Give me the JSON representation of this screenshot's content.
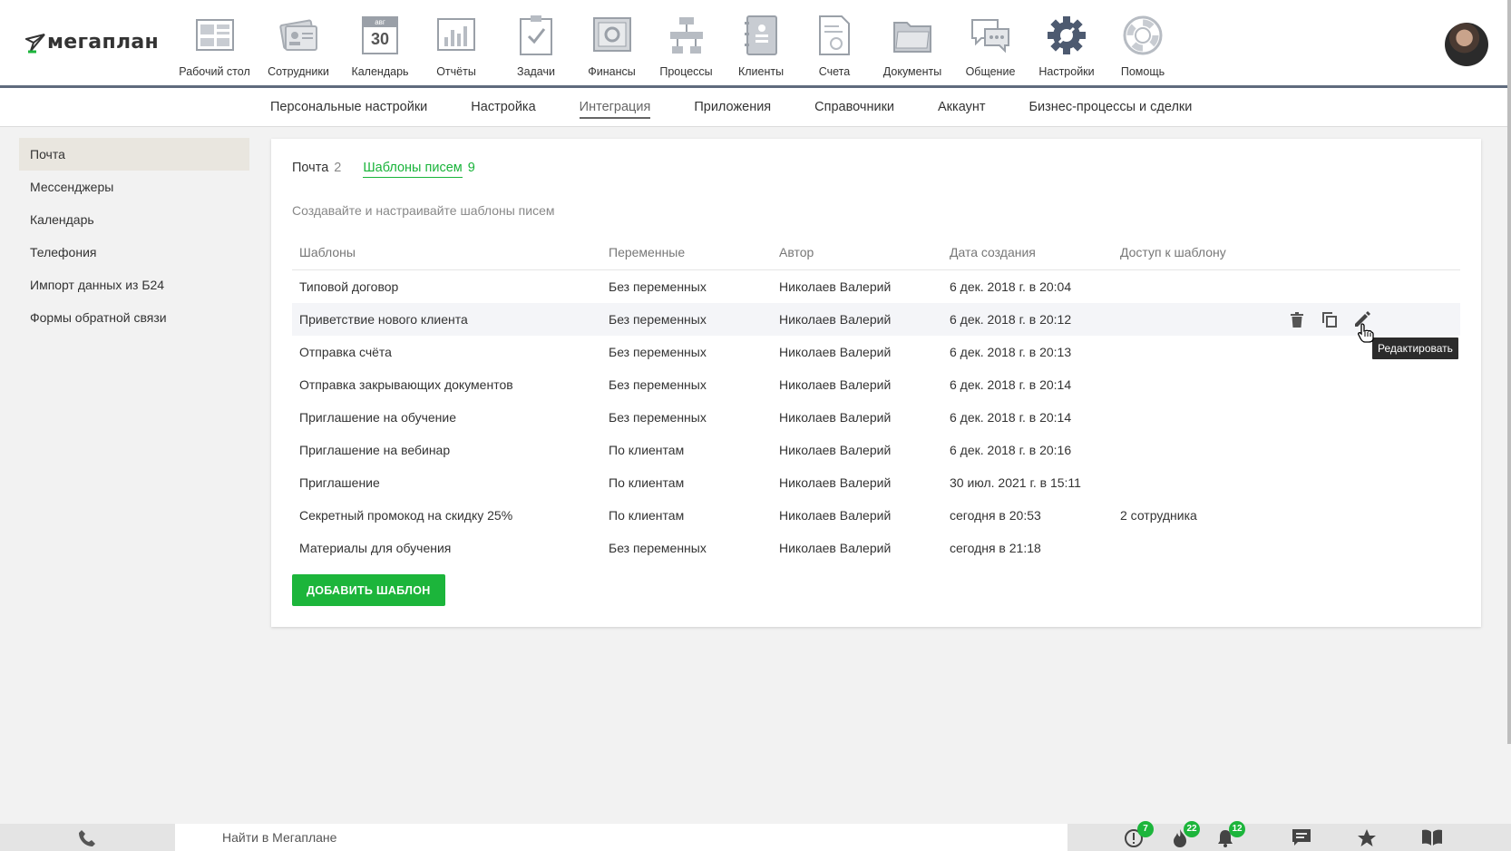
{
  "brand": {
    "name": "мегаплан"
  },
  "nav": [
    {
      "label": "Рабочий стол",
      "icon": "desktop-icon"
    },
    {
      "label": "Сотрудники",
      "icon": "employees-icon"
    },
    {
      "label": "Календарь",
      "icon": "calendar-icon",
      "month": "авг",
      "day": "30"
    },
    {
      "label": "Отчёты",
      "icon": "reports-icon"
    },
    {
      "label": "Задачи",
      "icon": "tasks-icon"
    },
    {
      "label": "Финансы",
      "icon": "finance-icon"
    },
    {
      "label": "Процессы",
      "icon": "processes-icon"
    },
    {
      "label": "Клиенты",
      "icon": "clients-icon"
    },
    {
      "label": "Счета",
      "icon": "invoices-icon"
    },
    {
      "label": "Документы",
      "icon": "documents-icon"
    },
    {
      "label": "Общение",
      "icon": "chat-icon"
    },
    {
      "label": "Настройки",
      "icon": "settings-icon",
      "active": true
    },
    {
      "label": "Помощь",
      "icon": "help-icon"
    }
  ],
  "subnav": [
    "Персональные настройки",
    "Настройка",
    "Интеграция",
    "Приложения",
    "Справочники",
    "Аккаунт",
    "Бизнес-процессы и сделки"
  ],
  "sidebar": [
    "Почта",
    "Мессенджеры",
    "Календарь",
    "Телефония",
    "Импорт данных из Б24",
    "Формы обратной связи"
  ],
  "tabs": [
    {
      "label": "Почта",
      "count": "2"
    },
    {
      "label": "Шаблоны писем",
      "count": "9"
    }
  ],
  "hint": "Создавайте и настраивайте шаблоны писем",
  "table": {
    "headers": [
      "Шаблоны",
      "Переменные",
      "Автор",
      "Дата создания",
      "Доступ к шаблону"
    ],
    "rows": [
      [
        "Типовой договор",
        "Без переменных",
        "Николаев Валерий",
        "6 дек. 2018 г. в 20:04",
        ""
      ],
      [
        "Приветствие нового клиента",
        "Без переменных",
        "Николаев Валерий",
        "6 дек. 2018 г. в 20:12",
        ""
      ],
      [
        "Отправка счёта",
        "Без переменных",
        "Николаев Валерий",
        "6 дек. 2018 г. в 20:13",
        ""
      ],
      [
        "Отправка закрывающих документов",
        "Без переменных",
        "Николаев Валерий",
        "6 дек. 2018 г. в 20:14",
        ""
      ],
      [
        "Приглашение на обучение",
        "Без переменных",
        "Николаев Валерий",
        "6 дек. 2018 г. в 20:14",
        ""
      ],
      [
        "Приглашение на вебинар",
        "По клиентам",
        "Николаев Валерий",
        "6 дек. 2018 г. в 20:16",
        ""
      ],
      [
        "Приглашение",
        "По клиентам",
        "Николаев Валерий",
        "30 июл. 2021 г. в 15:11",
        ""
      ],
      [
        "Секретный промокод на скидку 25%",
        "По клиентам",
        "Николаев Валерий",
        "сегодня в 20:53",
        "2 сотрудника"
      ],
      [
        "Материалы для обучения",
        "Без переменных",
        "Николаев Валерий",
        "сегодня в 21:18",
        ""
      ]
    ]
  },
  "tooltip": "Редактировать",
  "add_button": "ДОБАВИТЬ ШАБЛОН",
  "search_placeholder": "Найти в Мегаплане",
  "badges": {
    "alerts": "7",
    "hot": "22",
    "notifications": "12"
  },
  "colors": {
    "accent": "#1cb53b",
    "nav_border": "#5f6b7d",
    "sidebar_active": "#e9e6df"
  }
}
